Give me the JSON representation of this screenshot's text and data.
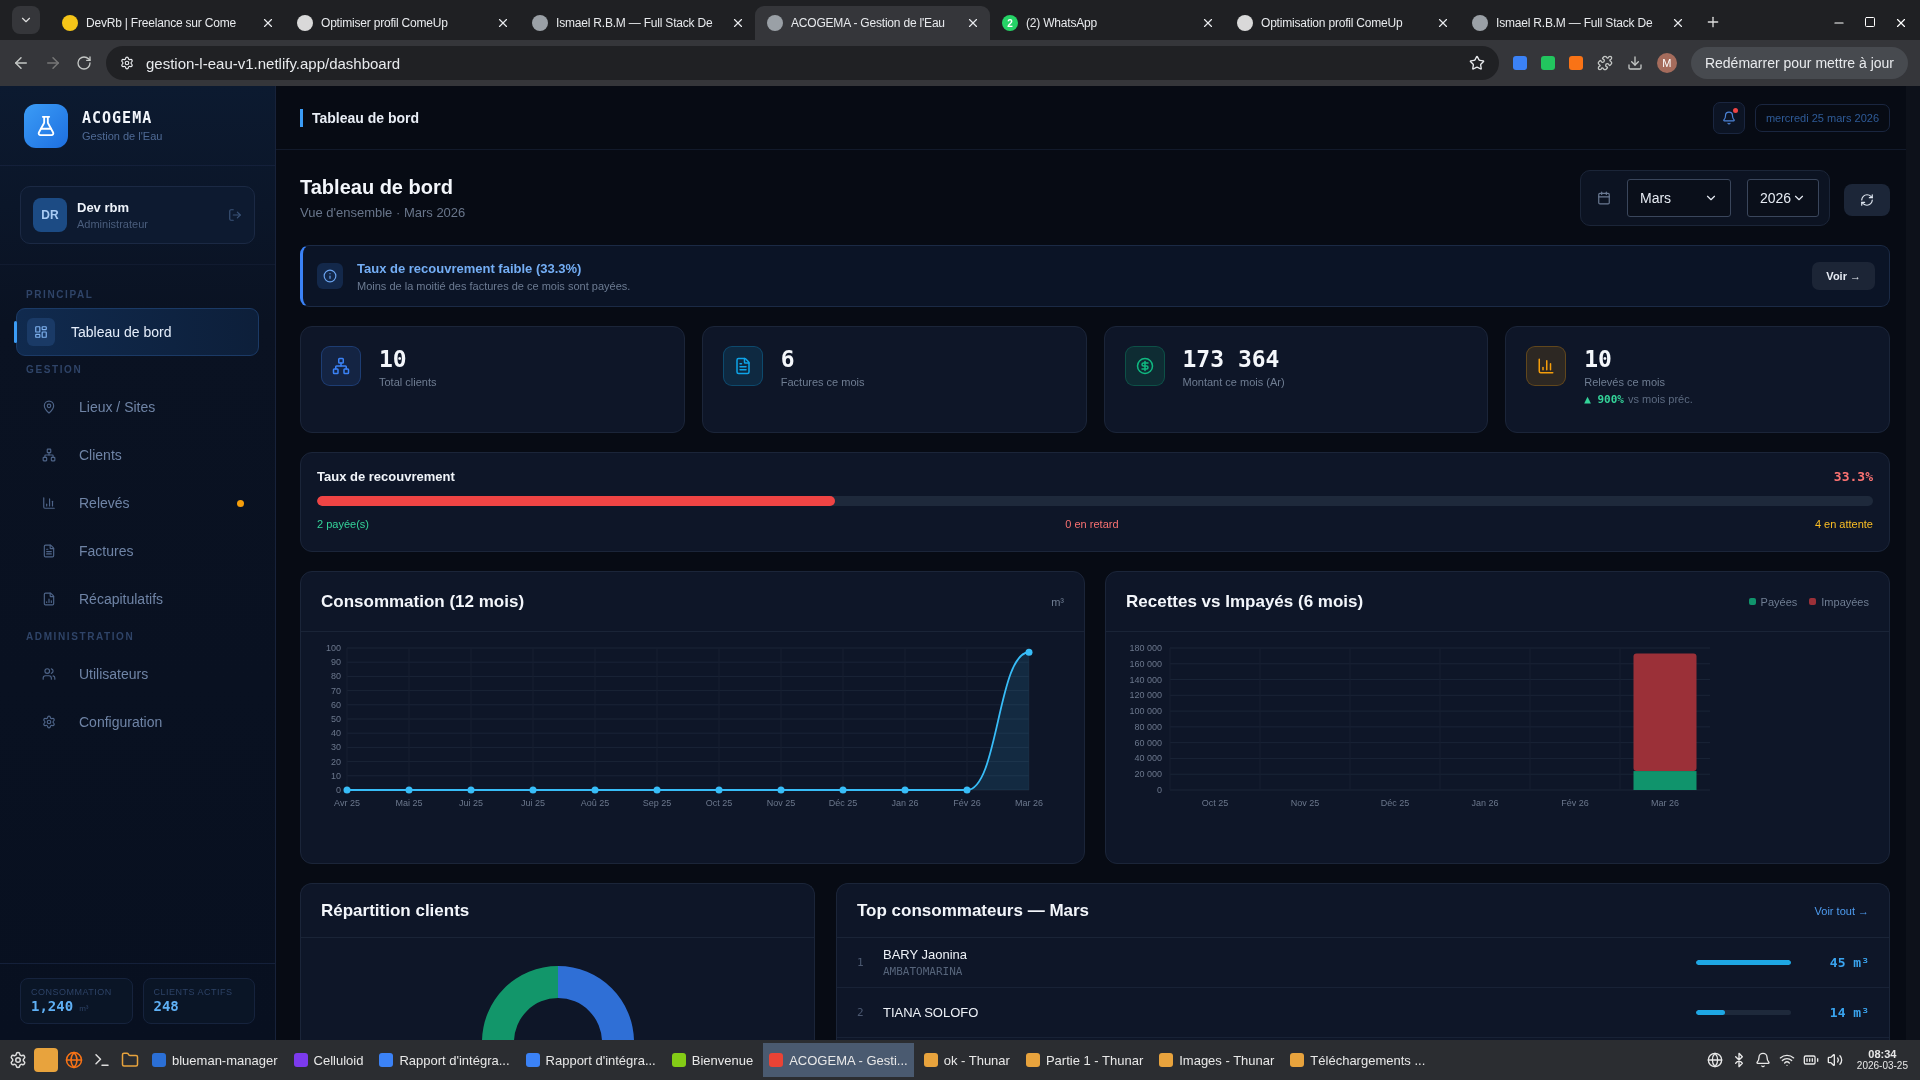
{
  "browser": {
    "tabs": [
      {
        "title": "DevRb | Freelance sur Come",
        "selected": false,
        "color": "#f5c518"
      },
      {
        "title": "Optimiser profil ComeUp",
        "selected": false,
        "color": "#d9d9d9"
      },
      {
        "title": "Ismael R.B.M — Full Stack De",
        "selected": false,
        "color": "#9aa0a6"
      },
      {
        "title": "ACOGEMA - Gestion de l'Eau",
        "selected": true,
        "color": "#9aa0a6"
      },
      {
        "title": "(2) WhatsApp",
        "selected": false,
        "color": "#25d366",
        "badge": "2"
      },
      {
        "title": "Optimisation profil ComeUp",
        "selected": false,
        "color": "#d9d9d9"
      },
      {
        "title": "Ismael R.B.M — Full Stack De",
        "selected": false,
        "color": "#9aa0a6"
      }
    ],
    "address": "gestion-l-eau-v1.netlify.app/dashboard",
    "profile": "M",
    "update_button": "Redémarrer pour mettre à jour"
  },
  "sidebar": {
    "brand": "ACOGEMA",
    "tagline": "Gestion de l'Eau",
    "user": {
      "initials": "DR",
      "name": "Dev rbm",
      "role": "Administrateur"
    },
    "sections": [
      {
        "label": "PRINCIPAL",
        "items": [
          {
            "label": "Tableau de bord",
            "selected": true,
            "alert_dot": false
          }
        ]
      },
      {
        "label": "GESTION",
        "items": [
          {
            "label": "Lieux / Sites",
            "selected": false,
            "alert_dot": false
          },
          {
            "label": "Clients",
            "selected": false,
            "alert_dot": false
          },
          {
            "label": "Relevés",
            "selected": false,
            "alert_dot": true
          },
          {
            "label": "Factures",
            "selected": false,
            "alert_dot": false
          },
          {
            "label": "Récapitulatifs",
            "selected": false,
            "alert_dot": false
          }
        ]
      },
      {
        "label": "ADMINISTRATION",
        "items": [
          {
            "label": "Utilisateurs",
            "selected": false,
            "alert_dot": false
          },
          {
            "label": "Configuration",
            "selected": false,
            "alert_dot": false
          }
        ]
      }
    ],
    "stats": [
      {
        "label": "CONSOMMATION",
        "value": "1,240",
        "unit": "m³"
      },
      {
        "label": "CLIENTS ACTIFS",
        "value": "248"
      }
    ]
  },
  "header": {
    "breadcrumb": "Tableau de bord",
    "has_unread": true,
    "date": "mercredi 25 mars 2026"
  },
  "page": {
    "title": "Tableau de bord",
    "subtitle": "Vue d'ensemble · Mars 2026",
    "month": "Mars",
    "year": "2026"
  },
  "alert": {
    "title": "Taux de recouvrement faible (33.3%)",
    "text": "Moins de la moitié des factures de ce mois sont payées.",
    "button": "Voir →"
  },
  "kpis": [
    {
      "value": "10",
      "label": "Total clients",
      "color": "#3b82f6"
    },
    {
      "value": "6",
      "label": "Factures ce mois",
      "color": "#0ea5e9"
    },
    {
      "value": "173 364",
      "label": "Montant ce mois (Ar)",
      "color": "#10b981"
    },
    {
      "value": "10",
      "label": "Relevés ce mois",
      "color": "#f59e0b",
      "trend": "▲ 900%",
      "trend_note": "vs mois préc."
    }
  ],
  "recovery": {
    "title": "Taux de recouvrement",
    "rate": "33.3%",
    "level": 0.333,
    "paid": "2 payée(s)",
    "late": "0 en retard",
    "pending": "4 en attente"
  },
  "consumption": {
    "title": "Consommation (12 mois)",
    "unit": "m³",
    "chart_data": {
      "type": "line",
      "categories": [
        "Avr 25",
        "Mai 25",
        "Jui 25",
        "Jui 25",
        "Aoû 25",
        "Sep 25",
        "Oct 25",
        "Nov 25",
        "Déc 25",
        "Jan 26",
        "Fév 26",
        "Mar 26"
      ],
      "series": [
        {
          "color": "#38bdf8",
          "marker": true,
          "values": [
            0,
            0,
            0,
            0,
            0,
            0,
            0,
            0,
            0,
            0,
            0,
            97
          ]
        }
      ],
      "grid": true,
      "ylim": [
        0,
        100
      ],
      "yticks": [
        0,
        10,
        20,
        30,
        40,
        50,
        60,
        70,
        80,
        90,
        100
      ]
    }
  },
  "revenue": {
    "title": "Recettes vs Impayés (6 mois)",
    "chart_data": {
      "type": "bar",
      "stacked": true,
      "categories": [
        "Oct 25",
        "Nov 25",
        "Déc 25",
        "Jan 26",
        "Fév 26",
        "Mar 26"
      ],
      "series": [
        {
          "name": "Payées",
          "color": "#10946c",
          "values": [
            0,
            0,
            0,
            0,
            0,
            24000
          ]
        },
        {
          "name": "Impayées",
          "color": "#9b3038",
          "values": [
            0,
            0,
            0,
            0,
            0,
            149000
          ]
        }
      ],
      "grid": true,
      "ylim": [
        0,
        180000
      ],
      "yticks": [
        {
          "value": 0,
          "label": "0"
        },
        {
          "value": 20000,
          "label": "20 000"
        },
        {
          "value": 40000,
          "label": "40 000"
        },
        {
          "value": 60000,
          "label": "60 000"
        },
        {
          "value": 80000,
          "label": "80 000"
        },
        {
          "value": 100000,
          "label": "100 000"
        },
        {
          "value": 120000,
          "label": "120 000"
        },
        {
          "value": 140000,
          "label": "140 000"
        },
        {
          "value": 160000,
          "label": "160 000"
        },
        {
          "value": 180000,
          "label": "180 000"
        }
      ]
    }
  },
  "distribution": {
    "title": "Répartition clients"
  },
  "top": {
    "title": "Top consommateurs — Mars",
    "link": "Voir tout →",
    "rows": [
      {
        "rank": "1",
        "name": "BARY Jaonina",
        "place": "AMBATOMARINA",
        "level": 1,
        "value": "45 m³"
      },
      {
        "rank": "2",
        "name": "TIANA SOLOFO",
        "level": 0.31,
        "value": "14 m³"
      }
    ]
  },
  "taskbar": {
    "items": [
      {
        "label": "blueman-manager",
        "selected": false
      },
      {
        "label": "Celluloid",
        "selected": false
      },
      {
        "label": "Rapport d'intégra...",
        "selected": false
      },
      {
        "label": "Rapport d'intégra...",
        "selected": false
      },
      {
        "label": "Bienvenue",
        "selected": false
      },
      {
        "label": "ACOGEMA - Gesti...",
        "selected": true
      },
      {
        "label": "ok - Thunar",
        "selected": false
      },
      {
        "label": "Partie 1 - Thunar",
        "selected": false
      },
      {
        "label": "Images - Thunar",
        "selected": false
      },
      {
        "label": "Téléchargements ...",
        "selected": false
      }
    ],
    "time": "08:34",
    "date": "2026-03-25"
  }
}
